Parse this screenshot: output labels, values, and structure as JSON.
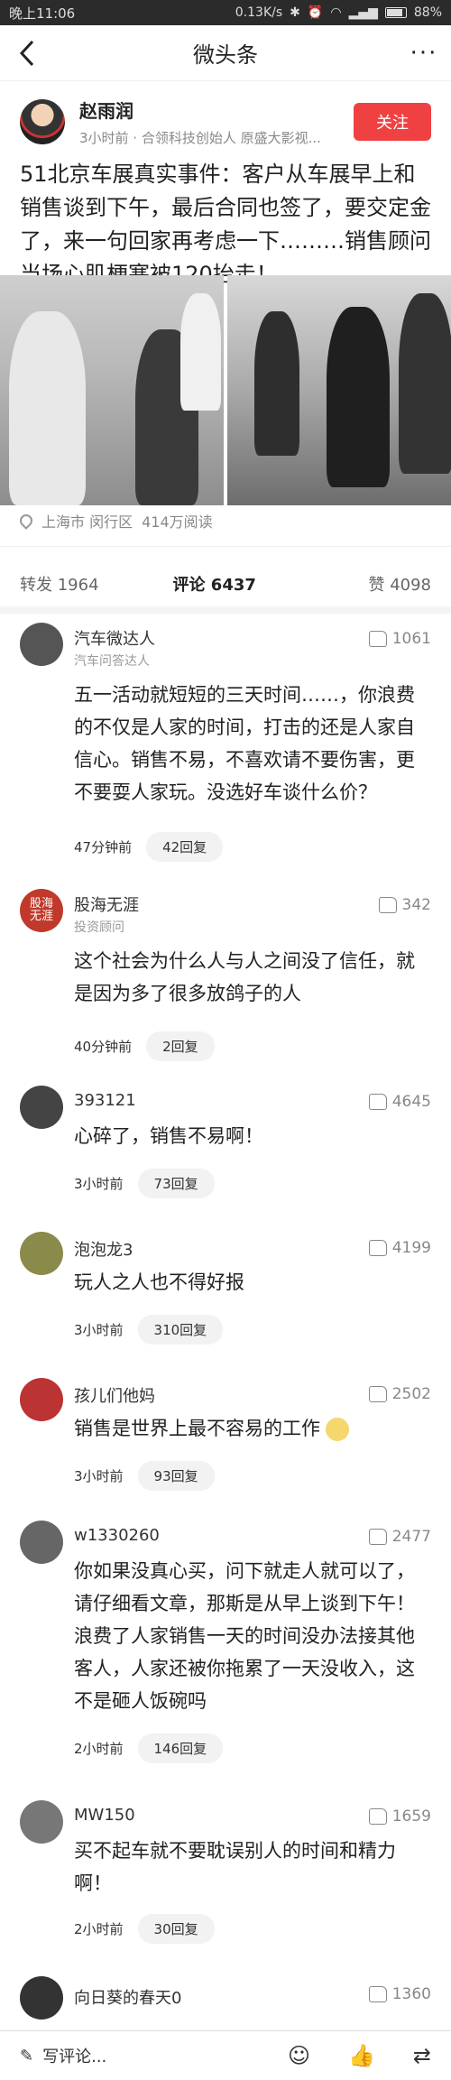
{
  "status_bar": {
    "time": "晚上11:06",
    "speed": "0.13K/s",
    "battery": "88%"
  },
  "nav": {
    "back_icon": "chevron-left-icon",
    "title": "微头条",
    "more_icon": "more-dots-icon",
    "more_label": "···"
  },
  "author": {
    "name": "赵雨润",
    "meta": "3小时前 · 合领科技创始人 原盛大影视...",
    "follow_label": "关注"
  },
  "headline": "51北京车展真实事件：客户从车展早上和销售谈到下午，最后合同也签了，要交定金了，来一句回家再考虑一下………销售顾问当场心肌梗塞被120抬走！",
  "location": {
    "place": "上海市 闵行区",
    "reads": "414万阅读"
  },
  "tabs": {
    "repost": "转发 1964",
    "comment": "评论 6437",
    "like": "赞 4098"
  },
  "comments": [
    {
      "name": "汽车微达人",
      "sub": "汽车问答达人",
      "likes": "1061",
      "text": "五一活动就短短的三天时间……，你浪费的不仅是人家的时间，打击的还是人家自信心。销售不易，不喜欢请不要伤害，更不要耍人家玩。没选好车谈什么价？",
      "time": "47分钟前",
      "replies": "42回复"
    },
    {
      "name": "股海无涯",
      "sub": "投资顾问",
      "likes": "342",
      "text": "这个社会为什么人与人之间没了信任，就是因为多了很多放鸽子的人",
      "time": "40分钟前",
      "replies": "2回复",
      "avatar_text": "股海无涯"
    },
    {
      "name": "393121",
      "sub": "",
      "likes": "4645",
      "text": "心碎了，销售不易啊！",
      "time": "3小时前",
      "replies": "73回复"
    },
    {
      "name": "泡泡龙3",
      "sub": "",
      "likes": "4199",
      "text": "玩人之人也不得好报",
      "time": "3小时前",
      "replies": "310回复"
    },
    {
      "name": "孩儿们他妈",
      "sub": "",
      "likes": "2502",
      "text": "销售是世界上最不容易的工作",
      "time": "3小时前",
      "replies": "93回复"
    },
    {
      "name": "w1330260",
      "sub": "",
      "likes": "2477",
      "text": "你如果没真心买，问下就走人就可以了，请仔细看文章，那斯是从早上谈到下午！浪费了人家销售一天的时间没办法接其他客人，人家还被你拖累了一天没收入，这不是砸人饭碗吗",
      "time": "2小时前",
      "replies": "146回复"
    },
    {
      "name": "MW150",
      "sub": "",
      "likes": "1659",
      "text": "买不起车就不要耽误别人的时间和精力啊！",
      "time": "2小时前",
      "replies": "30回复"
    },
    {
      "name": "向日葵的春天0",
      "sub": "",
      "likes": "1360",
      "text": "",
      "time": "",
      "replies": ""
    }
  ],
  "bottom_bar": {
    "write_placeholder": "写评论...",
    "icons": [
      "pen-icon",
      "emoji-icon",
      "like-icon",
      "share-icon"
    ]
  }
}
